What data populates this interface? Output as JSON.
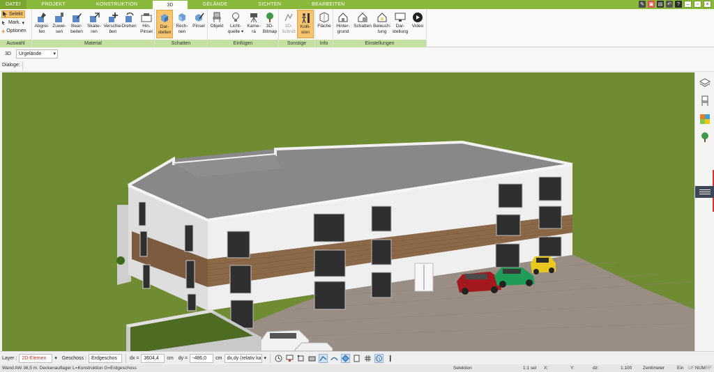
{
  "menu_tabs": [
    "DATEI",
    "PROJEKT",
    "KONSTRUKTION",
    "3D",
    "GELÄNDE",
    "SICHTEN",
    "BEARBEITEN"
  ],
  "active_tab": "3D",
  "ribbon": {
    "auswahl": {
      "items": [
        "Selekt",
        "Mark.",
        "Optionen"
      ],
      "footer": "Auswahl"
    },
    "material": {
      "buttons": [
        "Abgrei-\nfen",
        "Zuwei-\nsen",
        "Bear-\nbeiten",
        "Skalie-\nren",
        "Verschie-\nben",
        "Drehen",
        "Hin.\nPinsel"
      ],
      "footer": "Material"
    },
    "schatten": {
      "buttons": [
        "Dar-\nstellen",
        "Rech-\nnen",
        "Pinsel"
      ],
      "footer": "Schatten"
    },
    "einfuegen": {
      "buttons": [
        "Objekt",
        "Licht-\nquelle ▾",
        "Kame-\nra",
        "3D-\nBitmap"
      ],
      "footer": "Einfügen"
    },
    "sonstige": {
      "buttons": [
        "3D-\nSchnitt",
        "Kolli-\nsion"
      ],
      "footer": "Sonstige"
    },
    "info": {
      "buttons": [
        "Fläche"
      ],
      "footer": "Info"
    },
    "einstellungen": {
      "buttons": [
        "Hinter-\ngrund",
        "Schatten",
        "Beleuch-\ntung",
        "Dar-\nstellung",
        "Video"
      ],
      "footer": "Einstellungen"
    }
  },
  "viewbar": {
    "view_label": "3D",
    "terrain_select": "Urgelände"
  },
  "dialog_label": "Dialoge:",
  "inputbar": {
    "layer_label": "Layer :",
    "layer_value": "2D-Elemen",
    "floor_label": "Geschoss :",
    "floor_value": "Erdgeschos",
    "dx_label": "dx =",
    "dx_value": "3604,4",
    "dx_unit": "cm",
    "dy_label": "dy =",
    "dy_value": "-486,0",
    "dy_unit": "cm",
    "mode_value": "dx,dy (relativ ka"
  },
  "statusbar": {
    "hint": "Wand AW 36,5 m. Deckenauflager L=Konstruktion G=Erdgeschoss",
    "mode": "Selektion",
    "selection": "1:1 sel",
    "x_label": "X:",
    "y_label": "Y:",
    "dz_label": "dz:",
    "scale": "1:100",
    "unit": "Zentimeter",
    "ins": "Ein",
    "flags": [
      "UF",
      "NUM",
      "RF"
    ]
  },
  "colors": {
    "tab_green": "#8ab83a",
    "ribbon_footer": "#c5e1a0",
    "active_button": "#f7c470",
    "grass": "#6c8a31",
    "paving": "#9a8d83",
    "wall": "#ececec",
    "wood_cladding": "#8b6848"
  },
  "icons": {
    "right_sidebar": [
      "layers-icon",
      "furniture-chair-icon",
      "material-palette-icon",
      "tree-icon"
    ]
  }
}
